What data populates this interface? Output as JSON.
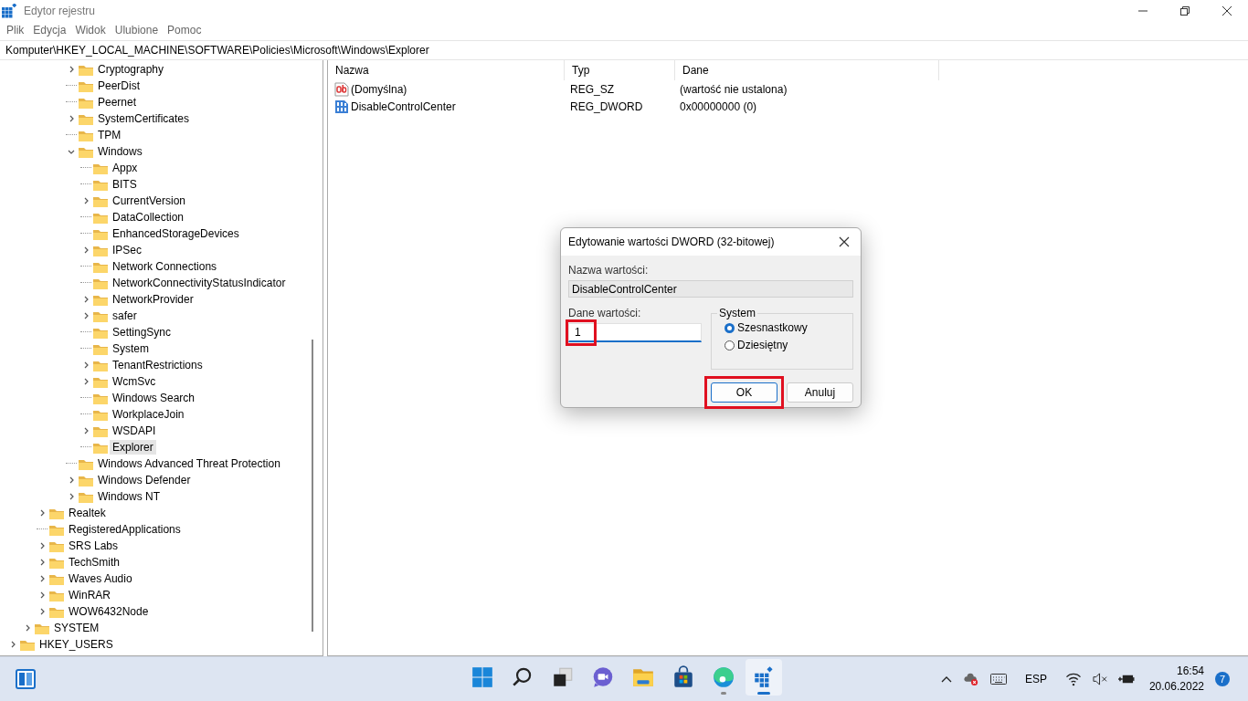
{
  "window": {
    "title": "Edytor rejestru"
  },
  "menu": [
    "Plik",
    "Edycja",
    "Widok",
    "Ulubione",
    "Pomoc"
  ],
  "address": "Komputer\\HKEY_LOCAL_MACHINE\\SOFTWARE\\Policies\\Microsoft\\Windows\\Explorer",
  "tree": [
    {
      "children": [
        {
          "children": [
            {
              "children": [
                {
                  "children": [
                    {
                      "label": "Cryptography",
                      "expandable": true,
                      "expanded": false,
                      "selected": false
                    },
                    {
                      "label": "PeerDist",
                      "expandable": false,
                      "expanded": false,
                      "selected": false
                    },
                    {
                      "label": "Peernet",
                      "expandable": false,
                      "expanded": false,
                      "selected": false
                    },
                    {
                      "label": "SystemCertificates",
                      "expandable": true,
                      "expanded": false,
                      "selected": false
                    },
                    {
                      "label": "TPM",
                      "expandable": false,
                      "expanded": false,
                      "selected": false
                    },
                    {
                      "label": "Windows",
                      "expandable": true,
                      "expanded": true,
                      "selected": false,
                      "children": [
                        {
                          "label": "Appx",
                          "expandable": false,
                          "expanded": false,
                          "selected": false
                        },
                        {
                          "label": "BITS",
                          "expandable": false,
                          "expanded": false,
                          "selected": false
                        },
                        {
                          "label": "CurrentVersion",
                          "expandable": true,
                          "expanded": false,
                          "selected": false
                        },
                        {
                          "label": "DataCollection",
                          "expandable": false,
                          "expanded": false,
                          "selected": false
                        },
                        {
                          "label": "EnhancedStorageDevices",
                          "expandable": false,
                          "expanded": false,
                          "selected": false
                        },
                        {
                          "label": "IPSec",
                          "expandable": true,
                          "expanded": false,
                          "selected": false
                        },
                        {
                          "label": "Network Connections",
                          "expandable": false,
                          "expanded": false,
                          "selected": false
                        },
                        {
                          "label": "NetworkConnectivityStatusIndicator",
                          "expandable": false,
                          "expanded": false,
                          "selected": false
                        },
                        {
                          "label": "NetworkProvider",
                          "expandable": true,
                          "expanded": false,
                          "selected": false
                        },
                        {
                          "label": "safer",
                          "expandable": true,
                          "expanded": false,
                          "selected": false
                        },
                        {
                          "label": "SettingSync",
                          "expandable": false,
                          "expanded": false,
                          "selected": false
                        },
                        {
                          "label": "System",
                          "expandable": false,
                          "expanded": false,
                          "selected": false
                        },
                        {
                          "label": "TenantRestrictions",
                          "expandable": true,
                          "expanded": false,
                          "selected": false
                        },
                        {
                          "label": "WcmSvc",
                          "expandable": true,
                          "expanded": false,
                          "selected": false
                        },
                        {
                          "label": "Windows Search",
                          "expandable": false,
                          "expanded": false,
                          "selected": false
                        },
                        {
                          "label": "WorkplaceJoin",
                          "expandable": false,
                          "expanded": false,
                          "selected": false
                        },
                        {
                          "label": "WSDAPI",
                          "expandable": true,
                          "expanded": false,
                          "selected": false
                        },
                        {
                          "label": "Explorer",
                          "expandable": false,
                          "expanded": false,
                          "selected": true
                        }
                      ]
                    },
                    {
                      "label": "Windows Advanced Threat Protection",
                      "expandable": false,
                      "expanded": false,
                      "selected": false
                    },
                    {
                      "label": "Windows Defender",
                      "expandable": true,
                      "expanded": false,
                      "selected": false
                    },
                    {
                      "label": "Windows NT",
                      "expandable": true,
                      "expanded": false,
                      "selected": false
                    }
                  ]
                }
              ]
            },
            {
              "label": "Realtek",
              "expandable": true,
              "expanded": false,
              "selected": false
            },
            {
              "label": "RegisteredApplications",
              "expandable": false,
              "expanded": false,
              "selected": false
            },
            {
              "label": "SRS Labs",
              "expandable": true,
              "expanded": false,
              "selected": false
            },
            {
              "label": "TechSmith",
              "expandable": true,
              "expanded": false,
              "selected": false
            },
            {
              "label": "Waves Audio",
              "expandable": true,
              "expanded": false,
              "selected": false
            },
            {
              "label": "WinRAR",
              "expandable": true,
              "expanded": false,
              "selected": false
            },
            {
              "label": "WOW6432Node",
              "expandable": true,
              "expanded": false,
              "selected": false
            }
          ]
        },
        {
          "label": "SYSTEM",
          "expandable": true,
          "expanded": false,
          "selected": false
        }
      ]
    },
    {
      "label": "HKEY_USERS",
      "expandable": true,
      "expanded": false,
      "selected": false
    }
  ],
  "table": {
    "columns": [
      "Nazwa",
      "Typ",
      "Dane"
    ],
    "rows": [
      {
        "kind": "string",
        "name": "(Domyślna)",
        "type": "REG_SZ",
        "data": "(wartość nie ustalona)"
      },
      {
        "kind": "binary",
        "name": "DisableControlCenter",
        "type": "REG_DWORD",
        "data": "0x00000000 (0)"
      }
    ]
  },
  "dialog": {
    "title": "Edytowanie wartości DWORD (32-bitowej)",
    "name_label": "Nazwa wartości:",
    "name_value": "DisableControlCenter",
    "data_label": "Dane wartości:",
    "data_value": "1",
    "data_highlighted": true,
    "base": {
      "title": "System",
      "options": [
        {
          "label": "Szesnastkowy",
          "selected": true
        },
        {
          "label": "Dziesiętny",
          "selected": false
        }
      ]
    },
    "buttons": [
      {
        "kind": "ok",
        "label": "OK",
        "highlighted": true
      },
      {
        "kind": "cancel",
        "label": "Anuluj",
        "highlighted": false
      }
    ]
  },
  "taskbar": {
    "apps": [
      {
        "kind": "start",
        "running": false,
        "active": false
      },
      {
        "kind": "search",
        "running": false,
        "active": false
      },
      {
        "kind": "taskview",
        "running": false,
        "active": false
      },
      {
        "kind": "chat",
        "running": false,
        "active": false
      },
      {
        "kind": "explorer",
        "running": false,
        "active": false
      },
      {
        "kind": "store",
        "running": false,
        "active": false
      },
      {
        "kind": "edge",
        "running": true,
        "active": false
      },
      {
        "kind": "regedit",
        "running": true,
        "active": true
      }
    ],
    "language": "ESP",
    "time": "16:54",
    "date": "20.06.2022",
    "notifications": "7"
  }
}
